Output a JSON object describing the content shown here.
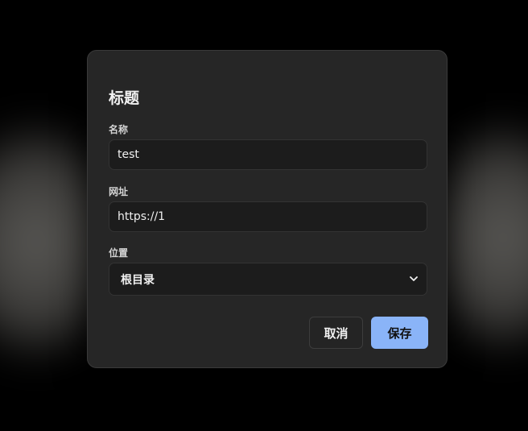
{
  "colors": {
    "dialog_bg": "#262626",
    "field_bg": "#1c1c1c",
    "accent": "#8ab4f8"
  },
  "dialog": {
    "title": "标题",
    "fields": {
      "name": {
        "label": "名称",
        "value": "test"
      },
      "url": {
        "label": "网址",
        "value": "https://1"
      },
      "location": {
        "label": "位置",
        "selected": "根目录"
      }
    },
    "buttons": {
      "cancel": "取消",
      "save": "保存"
    }
  },
  "icons": {
    "select_chevron": "chevron-down-icon"
  }
}
